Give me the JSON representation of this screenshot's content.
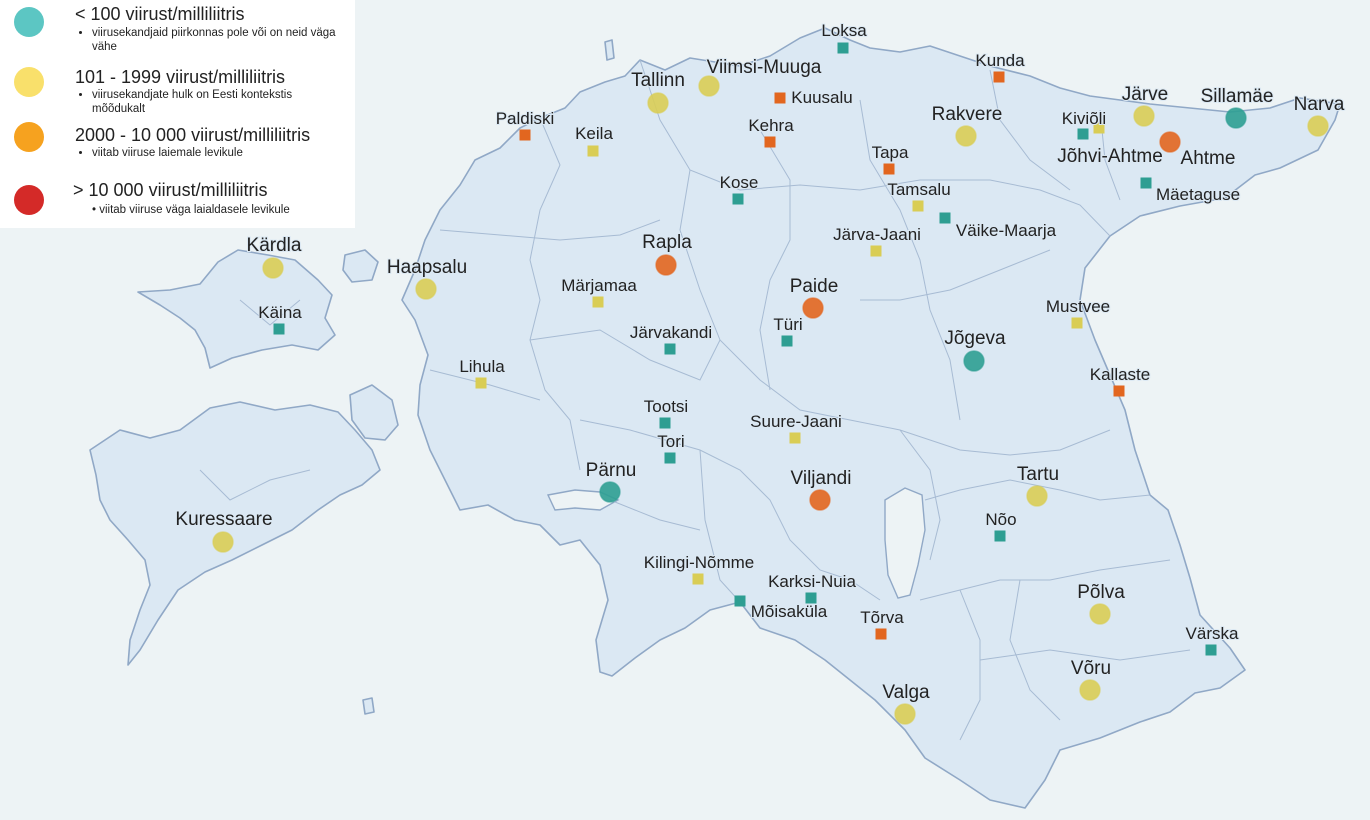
{
  "legend": {
    "items": [
      {
        "color": "#5cc6c3",
        "title": "< 100 viirust/milliliitris",
        "note": "viirusekandjaid piirkonnas pole või on neid väga vähe"
      },
      {
        "color": "#f9e06b",
        "title": "101 - 1999 viirust/milliliitris",
        "note": "viirusekandjate hulk on Eesti kontekstis mõõdukalt"
      },
      {
        "color": "#f6a21f",
        "title": "2000 - 10 000 viirust/milliliitris",
        "note": "viitab viiruse laiemale levikule"
      },
      {
        "color": "#d42a28",
        "title": "> 10 000 viirust/milliliitris",
        "note": "viitab viiruse väga laialdasele levikule"
      }
    ]
  },
  "colors": {
    "teal": "#2e9e92",
    "yellow": "#d9cd55",
    "orange": "#e2661f",
    "red": "#d42a28",
    "land": "#dbe8f3",
    "border": "#90a8c6",
    "sea": "#edf3f5"
  },
  "places": [
    {
      "name": "Loksa",
      "level": "teal",
      "kind": "square"
    },
    {
      "name": "Kunda",
      "level": "orange",
      "kind": "square"
    },
    {
      "name": "Tallinn",
      "level": "yellow",
      "kind": "circle"
    },
    {
      "name": "Viimsi-Muuga",
      "level": "yellow",
      "kind": "circle"
    },
    {
      "name": "Kuusalu",
      "level": "orange",
      "kind": "square"
    },
    {
      "name": "Paldiski",
      "level": "orange",
      "kind": "square"
    },
    {
      "name": "Keila",
      "level": "yellow",
      "kind": "square"
    },
    {
      "name": "Kehra",
      "level": "orange",
      "kind": "square"
    },
    {
      "name": "Rakvere",
      "level": "yellow",
      "kind": "circle"
    },
    {
      "name": "Tapa",
      "level": "orange",
      "kind": "square"
    },
    {
      "name": "Järve",
      "level": "yellow",
      "kind": "circle"
    },
    {
      "name": "Sillamäe",
      "level": "teal",
      "kind": "circle"
    },
    {
      "name": "Narva",
      "level": "yellow",
      "kind": "circle"
    },
    {
      "name": "Kiviõli",
      "level": "yellow",
      "kind": "square"
    },
    {
      "name": "Jõhvi-Ahtme",
      "level": "teal",
      "kind": "square"
    },
    {
      "name": "Ahtme",
      "level": "orange",
      "kind": "circle"
    },
    {
      "name": "Mäetaguse",
      "level": "teal",
      "kind": "square"
    },
    {
      "name": "Kose",
      "level": "teal",
      "kind": "square"
    },
    {
      "name": "Tamsalu",
      "level": "yellow",
      "kind": "square"
    },
    {
      "name": "Väike-Maarja",
      "level": "teal",
      "kind": "square"
    },
    {
      "name": "Järva-Jaani",
      "level": "yellow",
      "kind": "square"
    },
    {
      "name": "Kärdla",
      "level": "yellow",
      "kind": "circle"
    },
    {
      "name": "Haapsalu",
      "level": "yellow",
      "kind": "circle"
    },
    {
      "name": "Rapla",
      "level": "orange",
      "kind": "circle"
    },
    {
      "name": "Märjamaa",
      "level": "yellow",
      "kind": "square"
    },
    {
      "name": "Paide",
      "level": "orange",
      "kind": "circle"
    },
    {
      "name": "Käina",
      "level": "teal",
      "kind": "square"
    },
    {
      "name": "Türi",
      "level": "teal",
      "kind": "square"
    },
    {
      "name": "Järvakandi",
      "level": "teal",
      "kind": "square"
    },
    {
      "name": "Mustvee",
      "level": "yellow",
      "kind": "square"
    },
    {
      "name": "Jõgeva",
      "level": "teal",
      "kind": "circle"
    },
    {
      "name": "Lihula",
      "level": "yellow",
      "kind": "square"
    },
    {
      "name": "Kallaste",
      "level": "orange",
      "kind": "square"
    },
    {
      "name": "Tootsi",
      "level": "teal",
      "kind": "square"
    },
    {
      "name": "Suure-Jaani",
      "level": "yellow",
      "kind": "square"
    },
    {
      "name": "Tori",
      "level": "teal",
      "kind": "square"
    },
    {
      "name": "Pärnu",
      "level": "teal",
      "kind": "circle"
    },
    {
      "name": "Viljandi",
      "level": "orange",
      "kind": "circle"
    },
    {
      "name": "Tartu",
      "level": "yellow",
      "kind": "circle"
    },
    {
      "name": "Kuressaare",
      "level": "yellow",
      "kind": "circle"
    },
    {
      "name": "Nõo",
      "level": "teal",
      "kind": "square"
    },
    {
      "name": "Kilingi-Nõmme",
      "level": "yellow",
      "kind": "square"
    },
    {
      "name": "Karksi-Nuia",
      "level": "teal",
      "kind": "square"
    },
    {
      "name": "Mõisaküla",
      "level": "teal",
      "kind": "square"
    },
    {
      "name": "Põlva",
      "level": "yellow",
      "kind": "circle"
    },
    {
      "name": "Tõrva",
      "level": "orange",
      "kind": "square"
    },
    {
      "name": "Värska",
      "level": "teal",
      "kind": "square"
    },
    {
      "name": "Võru",
      "level": "yellow",
      "kind": "circle"
    },
    {
      "name": "Valga",
      "level": "yellow",
      "kind": "circle"
    }
  ]
}
